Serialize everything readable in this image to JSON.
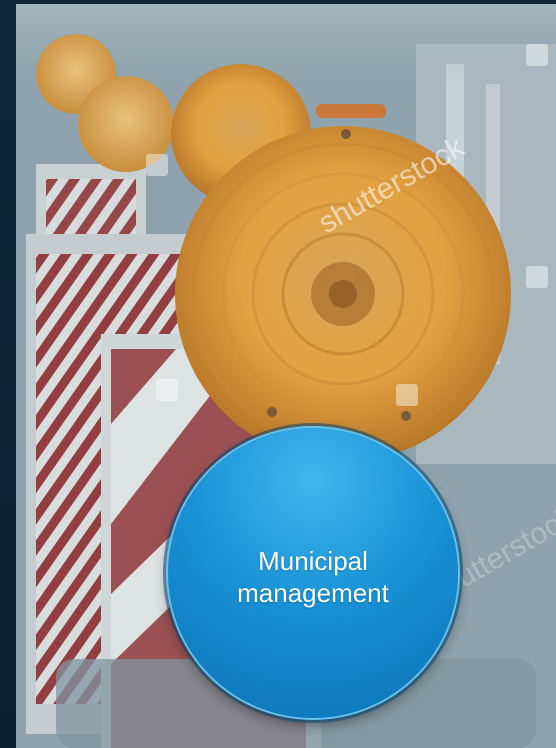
{
  "bubble": {
    "lines": [
      "Municipal",
      "management"
    ]
  },
  "watermark": {
    "text": "shutterstock"
  },
  "colors": {
    "background": "#0d2233",
    "bubble": "#1992d5",
    "bubble_border": "#63c4f2",
    "lamp": "#e0a030",
    "barrier_red": "#8d2f32"
  },
  "icons": {
    "watermark_mark": "shutterstock-logo-icon"
  }
}
